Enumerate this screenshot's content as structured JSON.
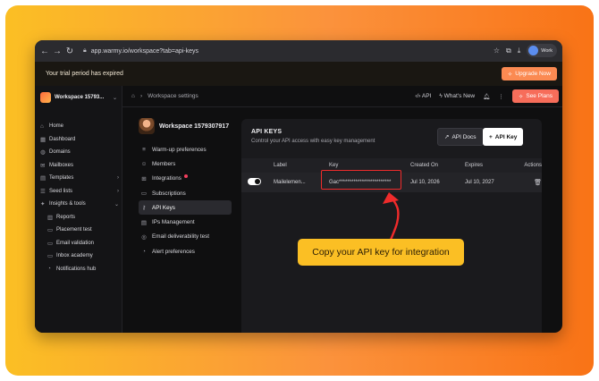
{
  "browser": {
    "url": "app.warmy.io/workspace?tab=api-keys",
    "profile_label": "Work"
  },
  "banner": {
    "text": "Your trial period has expired",
    "upgrade_label": "Upgrade Now"
  },
  "sidebar": {
    "workspace_label": "Workspace 15793...",
    "items": [
      {
        "label": "Home",
        "icon": "home-icon"
      },
      {
        "label": "Dashboard",
        "icon": "dashboard-icon"
      },
      {
        "label": "Domains",
        "icon": "globe-icon"
      },
      {
        "label": "Mailboxes",
        "icon": "mailbox-icon"
      },
      {
        "label": "Templates",
        "icon": "template-icon"
      },
      {
        "label": "Seed lists",
        "icon": "list-icon"
      },
      {
        "label": "Insights & tools",
        "icon": "insights-icon"
      },
      {
        "label": "Reports",
        "icon": "report-icon"
      },
      {
        "label": "Placement test",
        "icon": "placement-icon"
      },
      {
        "label": "Email validation",
        "icon": "validation-icon"
      },
      {
        "label": "Inbox academy",
        "icon": "academy-icon"
      },
      {
        "label": "Notifications hub",
        "icon": "bell-icon"
      }
    ]
  },
  "topbar": {
    "breadcrumb": "Workspace settings",
    "api_label": "API",
    "whats_new_label": "What's New",
    "see_plans_label": "See Plans"
  },
  "settings": {
    "workspace_name": "Workspace 1579307917",
    "items": [
      {
        "label": "Warm-up preferences"
      },
      {
        "label": "Members"
      },
      {
        "label": "Integrations"
      },
      {
        "label": "Subscriptions"
      },
      {
        "label": "API Keys"
      },
      {
        "label": "IPs Management"
      },
      {
        "label": "Email deliverability test"
      },
      {
        "label": "Alert preferences"
      }
    ]
  },
  "api_panel": {
    "title": "API KEYS",
    "subtitle": "Control your API access with easy key management",
    "docs_label": "API Docs",
    "add_key_label": "API Key",
    "columns": [
      "Label",
      "Key",
      "Created On",
      "Expires",
      "Actions"
    ],
    "rows": [
      {
        "label": "Mailelemen...",
        "key": "Gac*************************",
        "created": "Jul 10, 2026",
        "expires": "Jul 10, 2027"
      }
    ]
  },
  "callout": {
    "text": "Copy your API key for integration"
  },
  "colors": {
    "accent_orange": "#fb8a52",
    "see_plans": "#f76d5a",
    "callout_bg": "#fbbf24",
    "highlight_red": "#ef2b2b"
  }
}
